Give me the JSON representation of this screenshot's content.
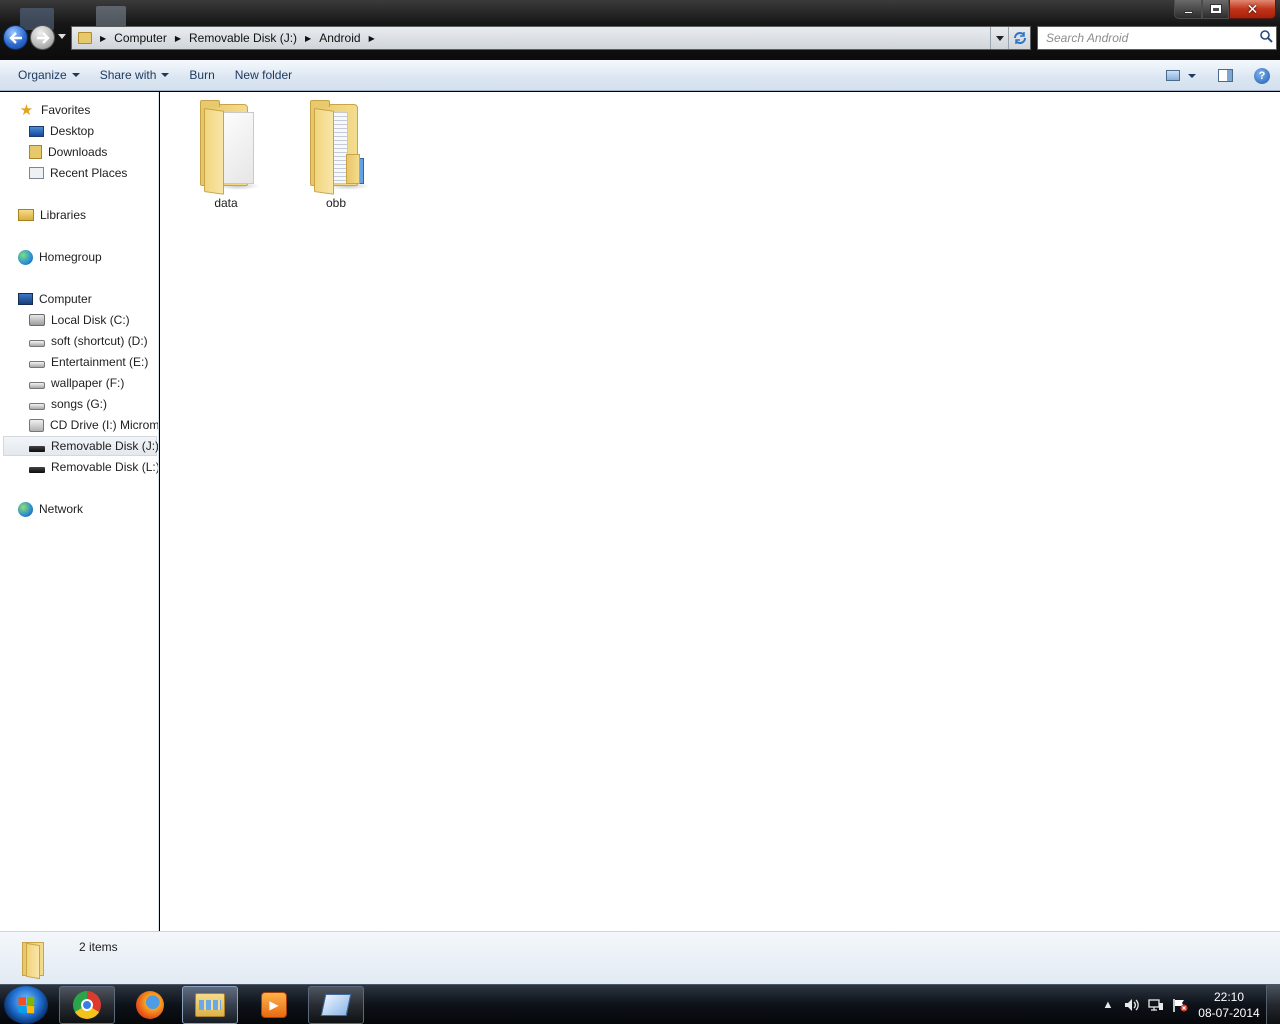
{
  "window": {
    "controls": {
      "close_glyph": "✕"
    }
  },
  "address_bar": {
    "breadcrumbs": [
      "Computer",
      "Removable Disk (J:)",
      "Android"
    ],
    "search_placeholder": "Search Android"
  },
  "toolbar": {
    "organize": "Organize",
    "share_with": "Share with",
    "burn": "Burn",
    "new_folder": "New folder",
    "help_glyph": "?"
  },
  "nav_pane": {
    "favorites": "Favorites",
    "desktop": "Desktop",
    "downloads": "Downloads",
    "recent_places": "Recent Places",
    "libraries": "Libraries",
    "homegroup": "Homegroup",
    "computer": "Computer",
    "drives": [
      "Local Disk (C:)",
      "soft (shortcut) (D:)",
      "Entertainment (E:)",
      "wallpaper (F:)",
      "songs (G:)",
      "CD Drive (I:) Microm",
      "Removable Disk (J:)",
      "Removable Disk (L:)"
    ],
    "selected": "Removable Disk (J:)",
    "network": "Network"
  },
  "content": {
    "items": [
      {
        "name": "data",
        "icon": "folder-icon"
      },
      {
        "name": "obb",
        "icon": "folder-with-files-icon"
      }
    ]
  },
  "details": {
    "item_count": "2 items"
  },
  "taskbar": {
    "apps": [
      "chrome-icon",
      "firefox-icon",
      "windows-explorer-icon",
      "media-player-icon",
      "app-icon"
    ],
    "clock_time": "22:10",
    "clock_date": "08-07-2014"
  },
  "colors": {
    "toolbar_text": "#1e395b",
    "close_button": "#c1341a",
    "content_bg": "#ffffff"
  }
}
